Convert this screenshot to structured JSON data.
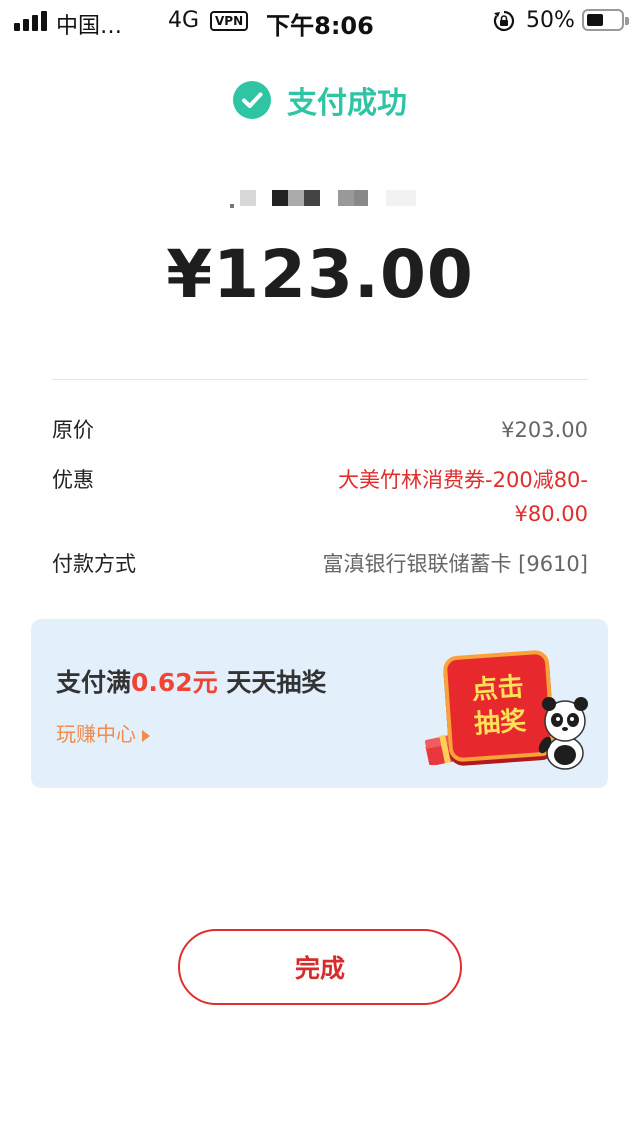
{
  "status_bar": {
    "carrier": "中国…",
    "network": "4G",
    "vpn": "VPN",
    "time": "下午8:06",
    "battery": "50%"
  },
  "header": {
    "success_text": "支付成功",
    "success_color": "#2ec4a4"
  },
  "payment": {
    "amount": "¥123.00"
  },
  "details": {
    "original_price_label": "原价",
    "original_price_value": "¥203.00",
    "discount_label": "优惠",
    "discount_line1": "大美竹林消费券-200减80-",
    "discount_line2": "¥80.00",
    "method_label": "付款方式",
    "method_value": "富滇银行银联储蓄卡 [9610]"
  },
  "banner": {
    "title_prefix": "支付满",
    "title_highlight": "0.62元",
    "title_suffix": " 天天抽奖",
    "link": "玩赚中心",
    "lottery_line1": "点击",
    "lottery_line2": "抽奖"
  },
  "actions": {
    "done_label": "完成",
    "accent_color": "#e02e2e"
  }
}
